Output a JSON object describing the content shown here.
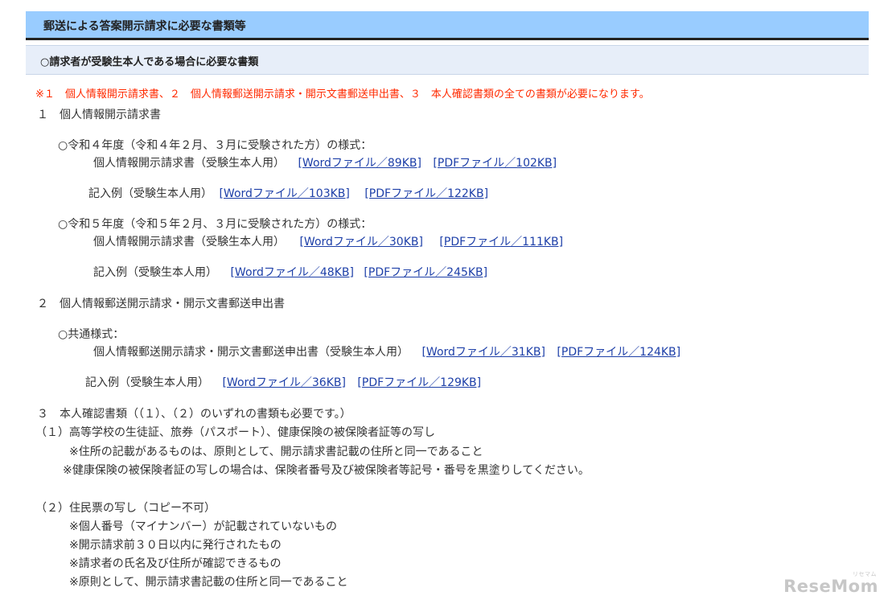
{
  "header": {
    "title": "郵送による答案開示請求に必要な書類等"
  },
  "subheader": {
    "title": "○請求者が受験生本人である場合に必要な書類"
  },
  "note": "※１　個人情報開示請求書、２　個人情報郵送開示請求・開示文書郵送申出書、３　本人確認書類の全ての書類が必要になります。",
  "section1": {
    "title": "１　個人情報開示請求書",
    "r4_heading": "○令和４年度（令和４年２月、３月に受験された方）の様式：",
    "r4_form_label": "個人情報開示請求書（受験生本人用）",
    "r4_form_word": "[Wordファイル／89KB]",
    "r4_form_pdf": "[PDFファイル／102KB]",
    "r4_example_label": "記入例（受験生本人用）",
    "r4_example_word": "[Wordファイル／103KB]",
    "r4_example_pdf": "[PDFファイル／122KB]",
    "r5_heading": "○令和５年度（令和５年２月、３月に受験された方）の様式：",
    "r5_form_label": "個人情報開示請求書（受験生本人用）",
    "r5_form_word": "[Wordファイル／30KB]",
    "r5_form_pdf": "[PDFファイル／111KB]",
    "r5_example_label": "記入例（受験生本人用）",
    "r5_example_word": "[Wordファイル／48KB]",
    "r5_example_pdf": "[PDFファイル／245KB]"
  },
  "section2": {
    "title": "２　個人情報郵送開示請求・開示文書郵送申出書",
    "common_heading": "○共通様式：",
    "form_label": "個人情報郵送開示請求・開示文書郵送申出書（受験生本人用）",
    "form_word": "[Wordファイル／31KB]",
    "form_pdf": "[PDFファイル／124KB]",
    "example_label": "記入例（受験生本人用）",
    "example_word": "[Wordファイル／36KB]",
    "example_pdf": "[PDFファイル／129KB]"
  },
  "section3": {
    "title": "３　本人確認書類（（１）、（２）のいずれの書類も必要です。）",
    "item1": "（１）高等学校の生徒証、旅券（パスポート）、健康保険の被保険者証等の写し",
    "item1_note1": "※住所の記載があるものは、原則として、開示請求書記載の住所と同一であること",
    "item1_note2": "※健康保険の被保険者証の写しの場合は、保険者番号及び被保険者等記号・番号を黒塗りしてください。",
    "item2": "（２）住民票の写し（コピー不可）",
    "item2_note1": "※個人番号（マイナンバー）が記載されていないもの",
    "item2_note2": "※開示請求前３０日以内に発行されたもの",
    "item2_note3": "※請求者の氏名及び住所が確認できるもの",
    "item2_note4": "※原則として、開示請求書記載の住所と同一であること"
  },
  "watermark": {
    "text": "ReseMom",
    "small": "リセマム"
  },
  "colors": {
    "header_bg": "#99ccff",
    "subheader_bg": "#e7eef9",
    "note_red": "#ff2a00",
    "link": "#1d3fa8"
  }
}
